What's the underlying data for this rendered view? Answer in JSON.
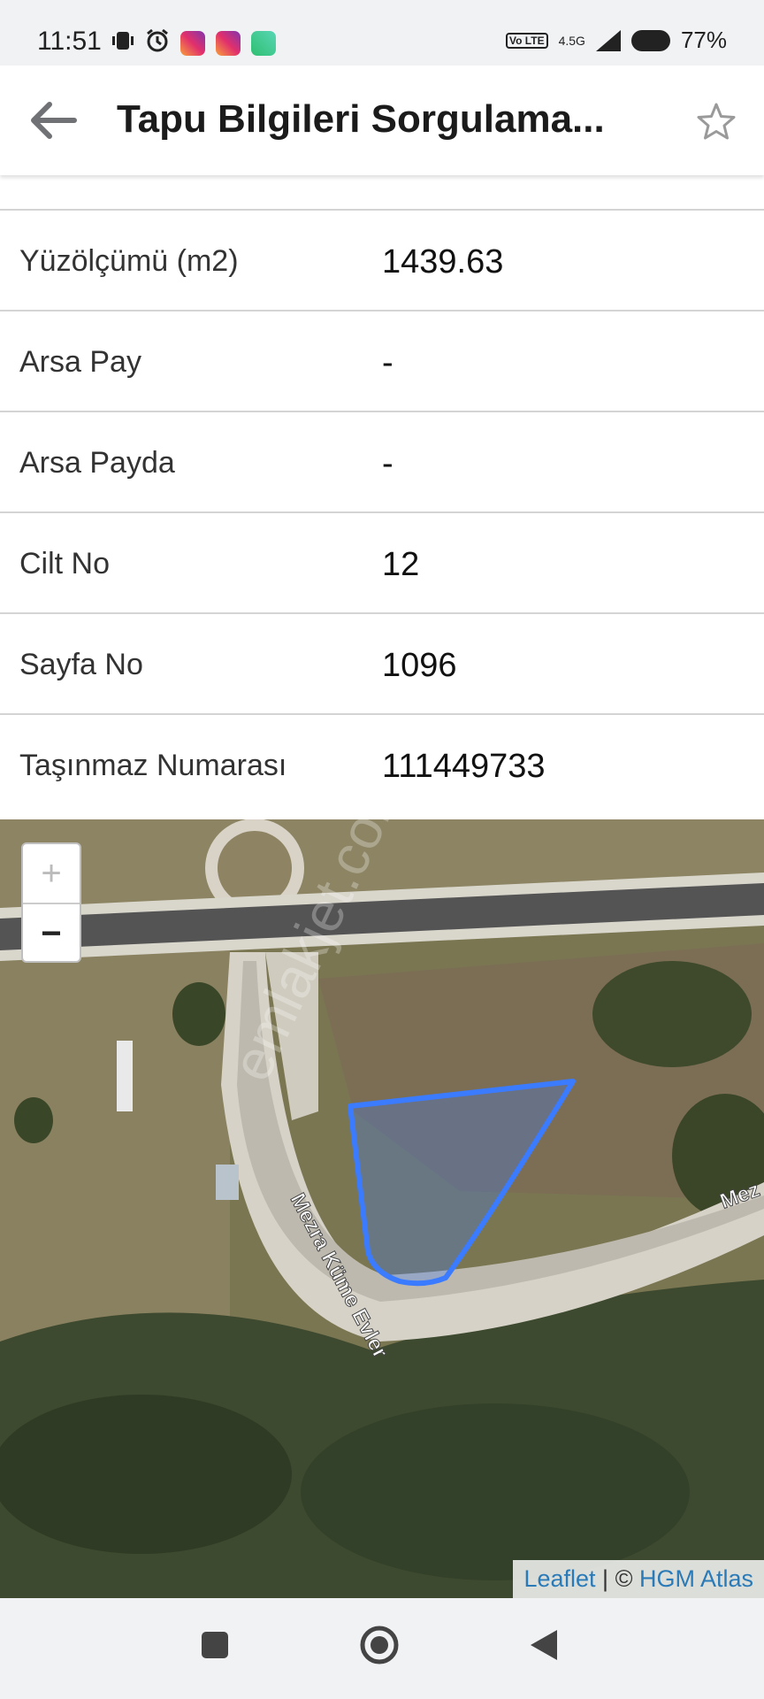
{
  "status_bar": {
    "time": "11:51",
    "network": "4.5G",
    "volte": "Vo LTE",
    "battery": "77%",
    "icons": [
      "vibrate-icon",
      "alarm-icon",
      "instagram-icon",
      "instagram-icon",
      "layers-app-icon"
    ]
  },
  "app_bar": {
    "title": "Tapu Bilgileri Sorgulama...",
    "back_icon": "back-arrow-icon",
    "favorite_icon": "star-outline-icon"
  },
  "details": [
    {
      "label": "Yüzölçümü (m2)",
      "value": "1439.63"
    },
    {
      "label": "Arsa Pay",
      "value": "-"
    },
    {
      "label": "Arsa Payda",
      "value": "-"
    },
    {
      "label": "Cilt No",
      "value": "12"
    },
    {
      "label": "Sayfa No",
      "value": "1096"
    },
    {
      "label": "Taşınmaz Numarası",
      "value": "111449733"
    }
  ],
  "map": {
    "zoom_in": "+",
    "zoom_out": "−",
    "road_label": "Mezra Küme Evler",
    "road_label_edge": "Mez",
    "watermark": "emlakjet.com",
    "attribution": {
      "leaflet": "Leaflet",
      "separator": " | © ",
      "source": "HGM Atlas"
    },
    "parcel_color": "#3b7bff"
  },
  "nav_bar": {
    "recent": "square-icon",
    "home": "circle-icon",
    "back": "triangle-back-icon"
  }
}
